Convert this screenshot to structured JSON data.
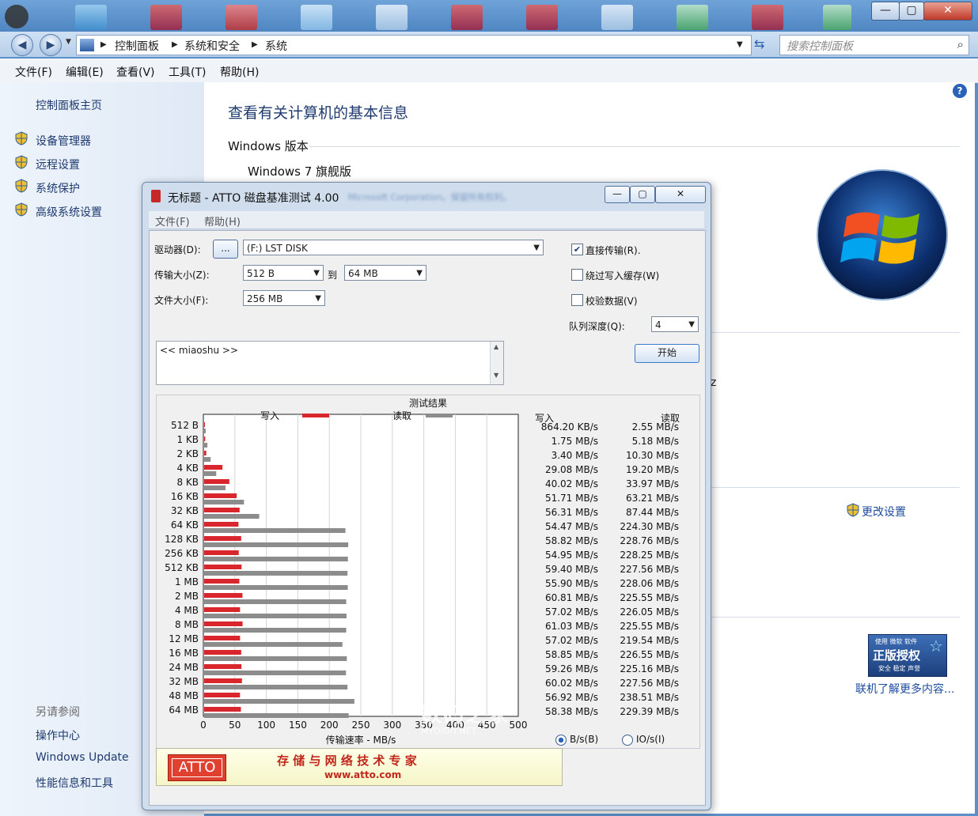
{
  "window": {
    "minimize": "—",
    "maximize": "▢",
    "close": "✕"
  },
  "address": {
    "crumbs": [
      "控制面板",
      "系统和安全",
      "系统"
    ],
    "search_placeholder": "搜索控制面板"
  },
  "menubar": [
    "文件(F)",
    "编辑(E)",
    "查看(V)",
    "工具(T)",
    "帮助(H)"
  ],
  "sidebar": {
    "home": "控制面板主页",
    "items": [
      "设备管理器",
      "远程设置",
      "系统保护",
      "高级系统设置"
    ],
    "see_also_title": "另请参阅",
    "see_also": [
      "操作中心",
      "Windows Update",
      "性能信息和工具"
    ]
  },
  "content": {
    "heading": "查看有关计算机的基本信息",
    "section_windows": "Windows 版本",
    "edition": "Windows 7 旗舰版",
    "copyright_blur": "Microsoft Corporation。保留所有权利。",
    "fragment_z": "z",
    "change_settings": "更改设置",
    "genuine_line1": "使用 微软 软件",
    "genuine_line2": "正版授权",
    "genuine_line3": "安全 稳定 声誉",
    "learn_more": "联机了解更多内容...",
    "help_icon": "?"
  },
  "atto": {
    "title": "无标题 - ATTO 磁盘基准测试 4.00",
    "menu": [
      "文件(F)",
      "帮助(H)"
    ],
    "drive_label": "驱动器(D):",
    "drive_browse": "...",
    "drive_value": "(F:) LST DISK",
    "transfer_label": "传输大小(Z):",
    "transfer_from": "512 B",
    "transfer_to_label": "到",
    "transfer_to": "64 MB",
    "filesize_label": "文件大小(F):",
    "filesize_value": "256 MB",
    "direct_io": "直接传输(R).",
    "direct_io_checked": true,
    "bypass_cache": "绕过写入缓存(W)",
    "verify": "校验数据(V)",
    "queue_label": "队列深度(Q):",
    "queue_value": "4",
    "start": "开始",
    "notes": "<< miaoshu >>",
    "results_title": "测试结果",
    "legend_write": "写入",
    "legend_read": "读取",
    "col_write": "写入",
    "col_read": "读取",
    "unit_bs": "B/s(B)",
    "unit_ios": "IO/s(I)",
    "banner_logo": "ATTO",
    "banner_slogan": "存 储 与 网 络 技 术 专 家",
    "banner_url": "www.atto.com",
    "watermark": "数码之家",
    "watermark_sub": "MYDIGIT.NET"
  },
  "chart_data": {
    "type": "bar",
    "orientation": "horizontal",
    "title": "测试结果",
    "xlabel": "传输速率 - MB/s",
    "xlim": [
      0,
      500
    ],
    "xticks": [
      0,
      50,
      100,
      150,
      200,
      250,
      300,
      350,
      400,
      450,
      500
    ],
    "categories": [
      "512 B",
      "1 KB",
      "2 KB",
      "4 KB",
      "8 KB",
      "16 KB",
      "32 KB",
      "64 KB",
      "128 KB",
      "256 KB",
      "512 KB",
      "1 MB",
      "2 MB",
      "4 MB",
      "8 MB",
      "12 MB",
      "16 MB",
      "24 MB",
      "32 MB",
      "48 MB",
      "64 MB"
    ],
    "series": [
      {
        "name": "写入",
        "color": "#d9262c",
        "values": [
          0.8642,
          1.75,
          3.4,
          29.08,
          40.02,
          51.71,
          56.31,
          54.47,
          58.82,
          54.95,
          59.4,
          55.9,
          60.81,
          57.02,
          61.03,
          57.02,
          58.85,
          59.26,
          60.02,
          56.92,
          58.38
        ],
        "labels": [
          "864.20 KB/s",
          "1.75 MB/s",
          "3.40 MB/s",
          "29.08 MB/s",
          "40.02 MB/s",
          "51.71 MB/s",
          "56.31 MB/s",
          "54.47 MB/s",
          "58.82 MB/s",
          "54.95 MB/s",
          "59.40 MB/s",
          "55.90 MB/s",
          "60.81 MB/s",
          "57.02 MB/s",
          "61.03 MB/s",
          "57.02 MB/s",
          "58.85 MB/s",
          "59.26 MB/s",
          "60.02 MB/s",
          "56.92 MB/s",
          "58.38 MB/s"
        ]
      },
      {
        "name": "读取",
        "color": "#8c8c8c",
        "values": [
          2.55,
          5.18,
          10.3,
          19.2,
          33.97,
          63.21,
          87.44,
          224.3,
          228.76,
          228.25,
          227.56,
          228.06,
          225.55,
          226.05,
          225.55,
          219.54,
          226.55,
          225.16,
          227.56,
          238.51,
          229.39
        ],
        "labels": [
          "2.55 MB/s",
          "5.18 MB/s",
          "10.30 MB/s",
          "19.20 MB/s",
          "33.97 MB/s",
          "63.21 MB/s",
          "87.44 MB/s",
          "224.30 MB/s",
          "228.76 MB/s",
          "228.25 MB/s",
          "227.56 MB/s",
          "228.06 MB/s",
          "225.55 MB/s",
          "226.05 MB/s",
          "225.55 MB/s",
          "219.54 MB/s",
          "226.55 MB/s",
          "225.16 MB/s",
          "227.56 MB/s",
          "238.51 MB/s",
          "229.39 MB/s"
        ]
      }
    ],
    "grid": true,
    "legend": "top"
  }
}
